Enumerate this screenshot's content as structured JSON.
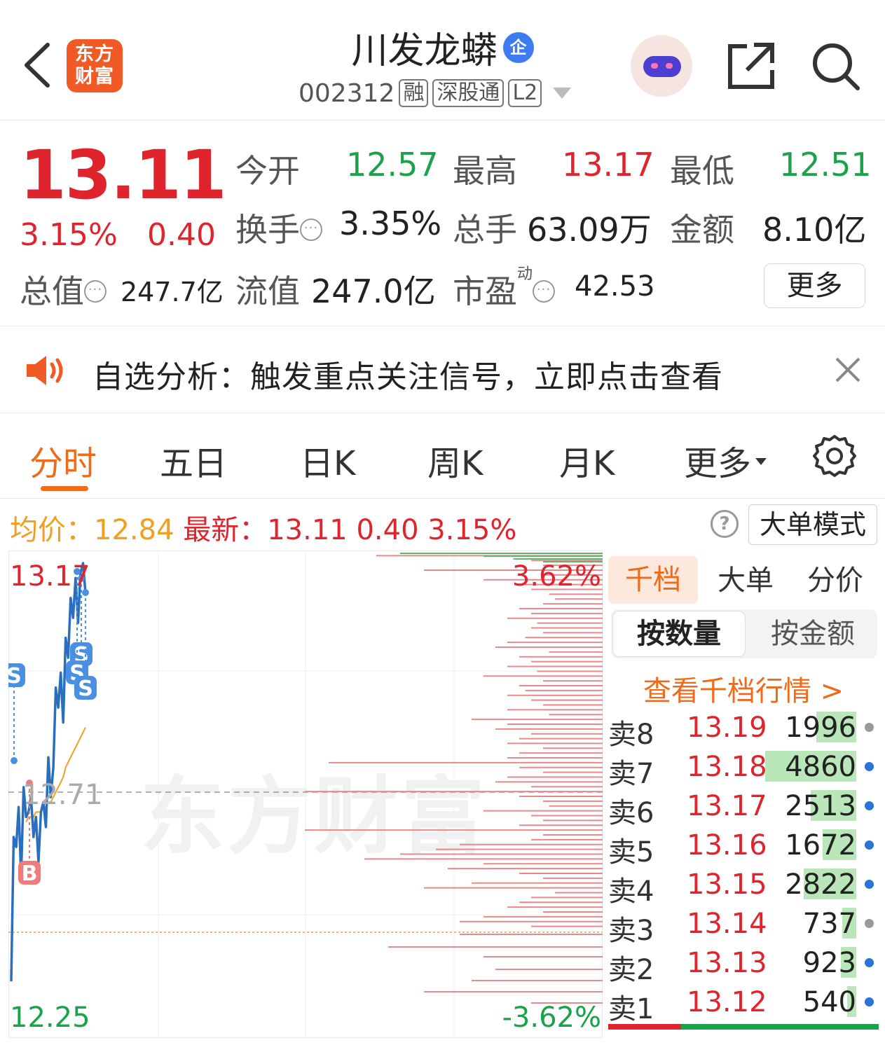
{
  "header": {
    "logo_line1": "东方",
    "logo_line2": "财富",
    "stock_name": "川发龙蟒",
    "qi_badge": "企",
    "code": "002312",
    "tags": [
      "融",
      "深股通",
      "L2"
    ],
    "icons": [
      "back-arrow-icon",
      "robot-avatar-icon",
      "share-icon",
      "search-icon"
    ]
  },
  "quote": {
    "price": "13.11",
    "change_pct": "3.15%",
    "change": "0.40",
    "open_label": "今开",
    "open": "12.57",
    "high_label": "最高",
    "high": "13.17",
    "low_label": "最低",
    "low": "12.51",
    "turnover_label": "换手",
    "turnover": "3.35%",
    "volume_label": "总手",
    "volume": "63.09万",
    "amount_label": "金额",
    "amount": "8.10亿",
    "total_cap_label": "总值",
    "total_cap": "247.7亿",
    "float_cap_label": "流值",
    "float_cap": "247.0亿",
    "pe_label": "市盈",
    "pe_sup": "动",
    "pe": "42.53",
    "info_glyph": "···",
    "more_button": "更多"
  },
  "banner": {
    "text": "自选分析：触发重点关注信号，立即点击查看",
    "close": "×"
  },
  "tabs": {
    "items": [
      "分时",
      "五日",
      "日K",
      "周K",
      "月K",
      "更多"
    ],
    "active": "分时"
  },
  "infoline": {
    "avg_label": "均价：",
    "avg": "12.84",
    "latest_label": "最新：",
    "latest": "13.11",
    "change": "0.40",
    "change_pct": "3.15%",
    "help": "?",
    "big_order_mode": "大单模式"
  },
  "chart_data": {
    "type": "line",
    "y_labels": {
      "top": "13.17",
      "mid": "12.71",
      "bottom": "12.25"
    },
    "pct_labels": {
      "top": "3.62%",
      "bottom": "-3.62%"
    },
    "ylim": [
      12.25,
      13.17
    ],
    "prev_close": 12.71,
    "watermark": "东方财富",
    "price_series": [
      12.33,
      12.62,
      12.6,
      12.68,
      12.54,
      12.72,
      12.66,
      12.67,
      12.7,
      12.62,
      12.66,
      12.57,
      12.67,
      12.69,
      12.64,
      12.78,
      12.7,
      12.76,
      12.92,
      12.88,
      12.95,
      12.85,
      13.02,
      12.98,
      13.1,
      13.06,
      13.14,
      13.05,
      13.15,
      13.17,
      13.11
    ],
    "avg_series": [
      12.6,
      12.62,
      12.63,
      12.64,
      12.64,
      12.65,
      12.65,
      12.66,
      12.66,
      12.66,
      12.67,
      12.67,
      12.67,
      12.68,
      12.68,
      12.69,
      12.69,
      12.7,
      12.71,
      12.72,
      12.73,
      12.74,
      12.76,
      12.77,
      12.78,
      12.79,
      12.8,
      12.81,
      12.82,
      12.83,
      12.84
    ],
    "trade_marks": [
      {
        "label": "S",
        "price": 13.02
      },
      {
        "label": "S",
        "price": 12.99
      },
      {
        "label": "S",
        "price": 12.95
      },
      {
        "label": "S",
        "price": 12.93
      },
      {
        "label": "B",
        "price": 12.51
      }
    ],
    "volume_profile_sell": [
      0.38,
      0.12,
      0.1,
      0.3,
      0.1,
      0.2,
      0.13,
      0.12,
      0.09,
      0.08,
      0.1,
      0.14,
      0.12,
      0.16,
      0.11,
      0.12,
      0.1,
      0.13,
      0.16,
      0.18,
      0.09,
      0.14,
      0.12,
      0.16,
      0.11,
      0.2,
      0.1,
      0.14,
      0.13,
      0.16,
      0.12,
      0.1,
      0.16,
      0.09,
      0.22,
      0.16,
      0.18,
      0.12,
      0.14,
      0.16,
      0.1,
      0.14,
      0.16,
      0.46,
      0.14,
      0.1,
      0.16,
      0.18,
      0.12,
      0.5,
      0.14,
      0.1,
      0.09,
      0.2,
      0.12,
      0.1,
      0.14,
      0.5,
      0.1,
      0.12,
      0.24,
      0.28,
      0.34,
      0.4,
      0.2,
      0.26,
      0.14,
      0.1,
      0.22,
      0.3,
      0.08,
      0.12,
      0.14,
      0.16,
      0.1,
      0.2,
      0.24,
      0.12
    ],
    "volume_profile_buy": [
      0.34,
      0.2,
      0.15,
      0.1
    ]
  },
  "orderbook": {
    "tabs": [
      "千档",
      "大单",
      "分价"
    ],
    "segment": [
      "按数量",
      "按金额"
    ],
    "link": "查看千档行情 >",
    "rows": [
      {
        "label": "卖8",
        "price": "13.19",
        "volume": "1996",
        "fill": 0.44,
        "dot": "#9a9a9a"
      },
      {
        "label": "卖7",
        "price": "13.18",
        "volume": "4860",
        "fill": 1.0,
        "dot": "#2a73d9"
      },
      {
        "label": "卖6",
        "price": "13.17",
        "volume": "2513",
        "fill": 0.5,
        "dot": "#2a73d9"
      },
      {
        "label": "卖5",
        "price": "13.16",
        "volume": "1672",
        "fill": 0.37,
        "dot": "#2a73d9"
      },
      {
        "label": "卖4",
        "price": "13.15",
        "volume": "2822",
        "fill": 0.58,
        "dot": "#2a73d9"
      },
      {
        "label": "卖3",
        "price": "13.14",
        "volume": "737",
        "fill": 0.15,
        "dot": "#9a9a9a"
      },
      {
        "label": "卖2",
        "price": "13.13",
        "volume": "923",
        "fill": 0.17,
        "dot": "#2a73d9"
      },
      {
        "label": "卖1",
        "price": "13.12",
        "volume": "540",
        "fill": 0.1,
        "dot": "#2a73d9"
      }
    ],
    "buy_sell_ratio": 0.27
  },
  "colors": {
    "up": "#e0242d",
    "down": "#1aa34a",
    "accent": "#ef6b1a",
    "avg": "#f0a01e",
    "line": "#2a6fbf"
  }
}
